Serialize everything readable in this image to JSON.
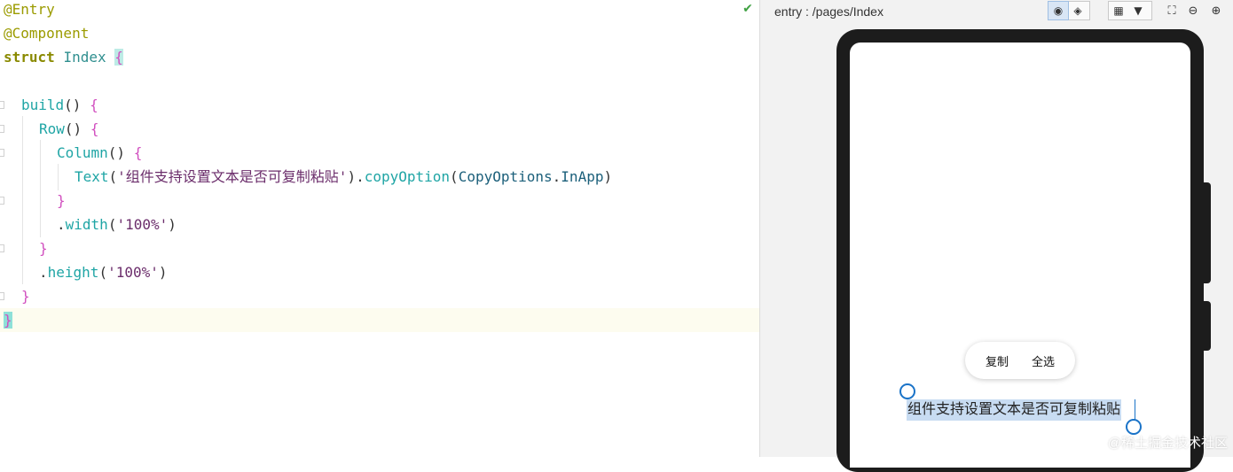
{
  "editor": {
    "tokens": {
      "entry": "@Entry",
      "component": "@Component",
      "struct_kw": "struct",
      "struct_name": "Index",
      "open_brace": "{",
      "close_brace": "}",
      "build": "build",
      "row": "Row",
      "column": "Column",
      "parens": "()",
      "text_fn": "Text",
      "text_arg": "'组件支持设置文本是否可复制粘贴'",
      "copy_method": "copyOption",
      "copy_enum": "CopyOptions",
      "copy_value": "InApp",
      "width_method": "width",
      "width_arg": "'100%'",
      "height_method": "height",
      "height_arg": "'100%'"
    }
  },
  "preview": {
    "path": "entry : /pages/Index",
    "menu_copy": "复制",
    "menu_select_all": "全选",
    "selected_text": "组件支持设置文本是否可复制粘贴",
    "watermark": "@稀土掘金技术社区"
  },
  "icons": {
    "status": "check-icon",
    "toolbar": [
      "inspect-icon",
      "layers-icon",
      "grid-icon",
      "dropdown-icon",
      "crop-icon",
      "zoom-out-icon",
      "zoom-in-icon"
    ]
  },
  "colors": {
    "annotation": "#9b9b00",
    "keyword": "#8a8a00",
    "function": "#1fa5a5",
    "brace": "#d14fbf",
    "string": "#6b2d6b",
    "selection": "#c8dcf2",
    "handle": "#1a73c8"
  }
}
